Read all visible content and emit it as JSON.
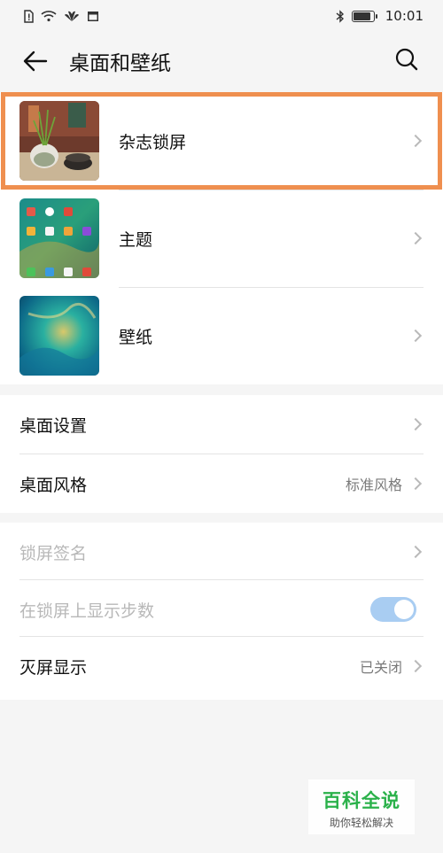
{
  "status_bar": {
    "time": "10:01",
    "left_icons": [
      "sim-alert-icon",
      "wifi-icon",
      "huawei-icon",
      "calendar-icon"
    ],
    "right_icons": [
      "bluetooth-icon",
      "battery-icon"
    ],
    "battery_level": 0.85
  },
  "header": {
    "title": "桌面和壁纸"
  },
  "group1": {
    "items": [
      {
        "label": "杂志锁屏",
        "highlighted": true
      },
      {
        "label": "主题"
      },
      {
        "label": "壁纸"
      }
    ]
  },
  "group2": {
    "items": [
      {
        "label": "桌面设置"
      },
      {
        "label": "桌面风格",
        "value": "标准风格"
      }
    ]
  },
  "group3": {
    "items": [
      {
        "label": "锁屏签名",
        "disabled": true
      },
      {
        "label": "在锁屏上显示步数",
        "disabled": true,
        "toggle_on": true
      },
      {
        "label": "灭屏显示",
        "value": "已关闭"
      }
    ]
  },
  "colors": {
    "highlight": "#ef8f4f",
    "toggle_track": "#a9cdf2",
    "watermark_green": "#2ab14a"
  },
  "watermark": {
    "title": "百科全说",
    "subtitle": "助你轻松解决"
  }
}
